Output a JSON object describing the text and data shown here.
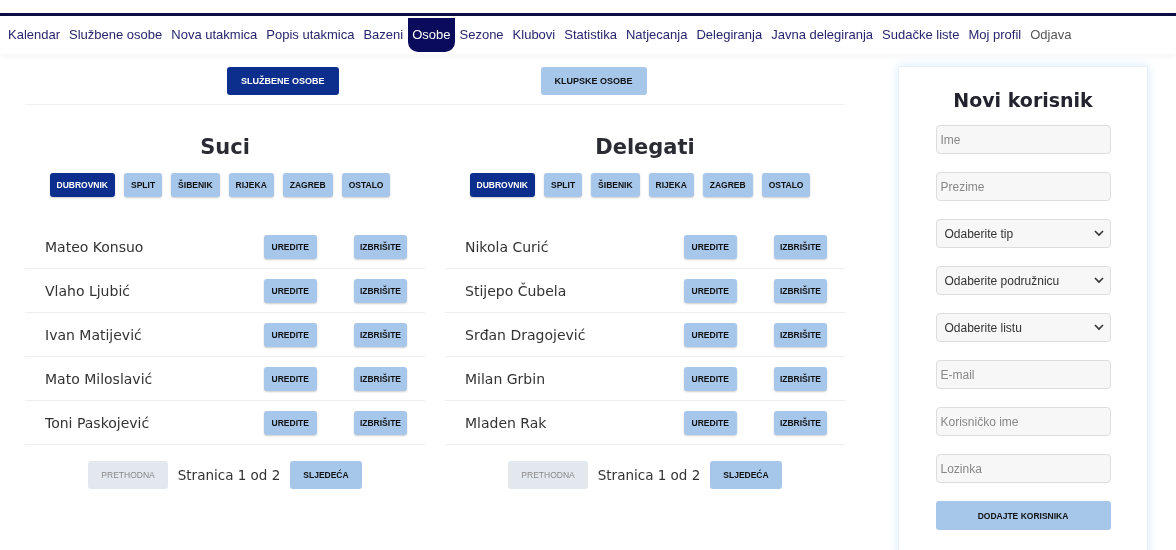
{
  "nav": [
    {
      "label": "Kalendar",
      "selected": false
    },
    {
      "label": "Službene osobe",
      "selected": false
    },
    {
      "label": "Nova utakmica",
      "selected": false
    },
    {
      "label": "Popis utakmica",
      "selected": false
    },
    {
      "label": "Bazeni",
      "selected": false
    },
    {
      "label": "Osobe",
      "selected": true
    },
    {
      "label": "Sezone",
      "selected": false
    },
    {
      "label": "Klubovi",
      "selected": false
    },
    {
      "label": "Statistika",
      "selected": false
    },
    {
      "label": "Natjecanja",
      "selected": false
    },
    {
      "label": "Delegiranja",
      "selected": false
    },
    {
      "label": "Javna delegiranja",
      "selected": false
    },
    {
      "label": "Sudačke liste",
      "selected": false
    },
    {
      "label": "Moj profil",
      "selected": false
    },
    {
      "label": "Odjava",
      "selected": false,
      "kind": "logout"
    }
  ],
  "section_tabs": [
    {
      "label": "SLUŽBENE OSOBE",
      "selected": true
    },
    {
      "label": "KLUPSKE OSOBE",
      "selected": false
    }
  ],
  "panels": [
    {
      "title": "Suci",
      "filters": [
        {
          "label": "DUBROVNIK",
          "selected": true
        },
        {
          "label": "SPLIT",
          "selected": false
        },
        {
          "label": "ŠIBENIK",
          "selected": false
        },
        {
          "label": "RIJEKA",
          "selected": false
        },
        {
          "label": "ZAGREB",
          "selected": false
        },
        {
          "label": "OSTALO",
          "selected": false
        }
      ],
      "people": [
        {
          "name": "Mateo Konsuo",
          "actions": [
            "UREDITE",
            "IZBRIŠITE"
          ]
        },
        {
          "name": "Vlaho Ljubić",
          "actions": [
            "UREDITE",
            "IZBRIŠITE"
          ]
        },
        {
          "name": "Ivan Matijević",
          "actions": [
            "UREDITE",
            "IZBRIŠITE"
          ]
        },
        {
          "name": "Mato Miloslavić",
          "actions": [
            "UREDITE",
            "IZBRIŠITE"
          ]
        },
        {
          "name": "Toni Paskojević",
          "actions": [
            "UREDITE",
            "IZBRIŠITE"
          ]
        }
      ],
      "pagination": {
        "prev": {
          "label": "PRETHODNA",
          "disabled": true
        },
        "page_text": "Stranica 1 od 2",
        "next": {
          "label": "SLJEDEĆA",
          "disabled": false
        }
      }
    },
    {
      "title": "Delegati",
      "filters": [
        {
          "label": "DUBROVNIK",
          "selected": true
        },
        {
          "label": "SPLIT",
          "selected": false
        },
        {
          "label": "ŠIBENIK",
          "selected": false
        },
        {
          "label": "RIJEKA",
          "selected": false
        },
        {
          "label": "ZAGREB",
          "selected": false
        },
        {
          "label": "OSTALO",
          "selected": false
        }
      ],
      "people": [
        {
          "name": "Nikola Curić",
          "actions": [
            "UREDITE",
            "IZBRIŠITE"
          ]
        },
        {
          "name": "Stijepo Čubela",
          "actions": [
            "UREDITE",
            "IZBRIŠITE"
          ]
        },
        {
          "name": "Srđan Dragojević",
          "actions": [
            "UREDITE",
            "IZBRIŠITE"
          ]
        },
        {
          "name": "Milan Grbin",
          "actions": [
            "UREDITE",
            "IZBRIŠITE"
          ]
        },
        {
          "name": "Mladen Rak",
          "actions": [
            "UREDITE",
            "IZBRIŠITE"
          ]
        }
      ],
      "pagination": {
        "prev": {
          "label": "PRETHODNA",
          "disabled": true
        },
        "page_text": "Stranica 1 od 2",
        "next": {
          "label": "SLJEDEĆA",
          "disabled": false
        }
      }
    }
  ],
  "form": {
    "title": "Novi korisnik",
    "fields": [
      {
        "kind": "input",
        "placeholder": "Ime"
      },
      {
        "kind": "input",
        "placeholder": "Prezime"
      },
      {
        "kind": "select",
        "value": "Odaberite tip"
      },
      {
        "kind": "select",
        "value": "Odaberite podružnicu"
      },
      {
        "kind": "select",
        "value": "Odaberite listu"
      },
      {
        "kind": "input",
        "placeholder": "E-mail"
      },
      {
        "kind": "input",
        "placeholder": "Korisničko ime"
      },
      {
        "kind": "input",
        "placeholder": "Lozinka"
      }
    ],
    "submit": "DODAJTE KORISNIKA"
  }
}
